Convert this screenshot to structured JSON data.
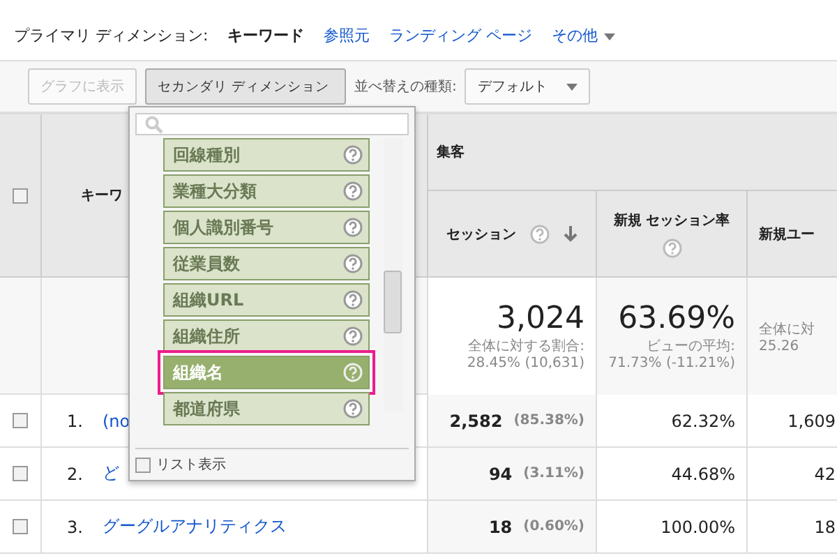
{
  "primary": {
    "label": "プライマリ ディメンション:",
    "items": [
      {
        "label": "キーワード",
        "selected": true
      },
      {
        "label": "参照元",
        "selected": false
      },
      {
        "label": "ランディング ページ",
        "selected": false
      },
      {
        "label": "その他",
        "selected": false
      }
    ]
  },
  "toolbar": {
    "graph_button": {
      "label": "グラフに表示",
      "disabled": true
    },
    "secondary_button": "セカンダリ ディメンション",
    "sort_label": "並べ替えの種類:",
    "sort_value": "デフォルト"
  },
  "dropdown": {
    "items": [
      {
        "label": "回線種別",
        "selected": false
      },
      {
        "label": "業種大分類",
        "selected": false
      },
      {
        "label": "個人識別番号",
        "selected": false
      },
      {
        "label": "従業員数",
        "selected": false
      },
      {
        "label": "組織URL",
        "selected": false
      },
      {
        "label": "組織住所",
        "selected": false
      },
      {
        "label": "組織名",
        "selected": true
      },
      {
        "label": "都道府県",
        "selected": false
      }
    ],
    "list_view": {
      "label": "リスト表示",
      "checked": false
    }
  },
  "table": {
    "select_all_checked": false,
    "group": "集客",
    "columns": [
      "キーワ",
      "セッション",
      "新規 セッション率",
      "新規ユー"
    ],
    "summary": [
      {
        "value": "3,024",
        "sub1": "全体に対する割合:",
        "sub2": "28.45% (10,631)"
      },
      {
        "value": "63.69%",
        "sub1": "ビューの平均:",
        "sub2": "71.73% (-11.21%)"
      },
      {
        "sub1": "全体に対",
        "sub2": "25.26"
      }
    ],
    "rows": [
      {
        "num": "1.",
        "keyword": "(no",
        "sessions": "2,582",
        "share": "(85.38%)",
        "rate": "62.32%",
        "users": "1,609",
        "checked": false
      },
      {
        "num": "2.",
        "keyword": "ど",
        "sessions": "94",
        "share": "(3.11%)",
        "rate": "44.68%",
        "users": "42",
        "checked": false
      },
      {
        "num": "3.",
        "keyword": "グーグルアナリティクス",
        "sessions": "18",
        "share": "(0.60%)",
        "rate": "100.00%",
        "users": "18",
        "checked": false
      }
    ]
  }
}
